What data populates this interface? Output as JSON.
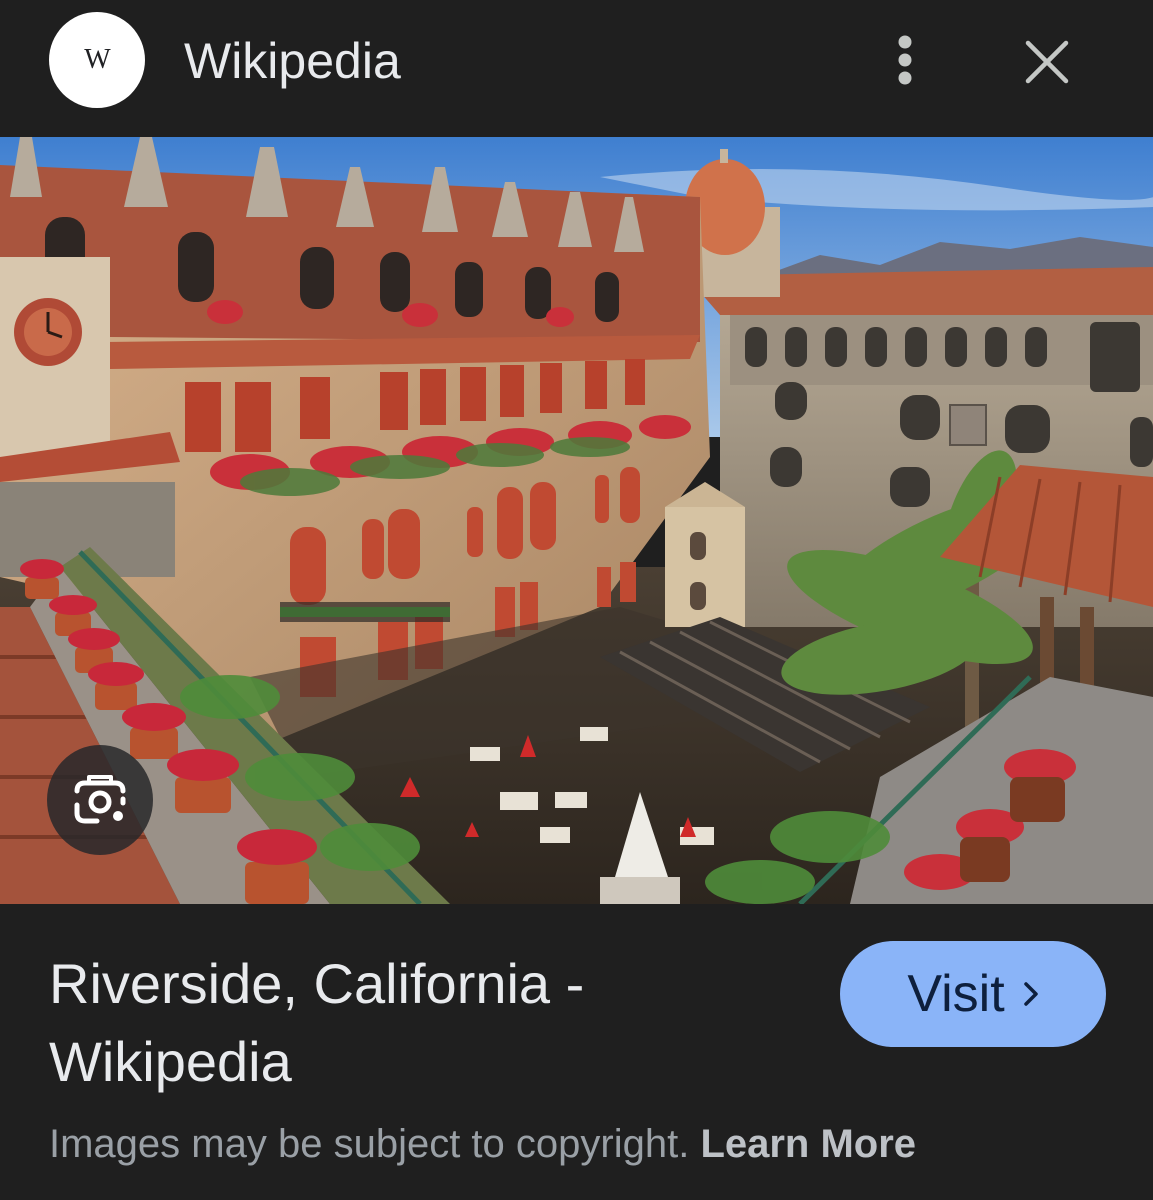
{
  "header": {
    "logo_letter": "W",
    "site_name": "Wikipedia"
  },
  "icons": {
    "logo": "wikipedia-logo",
    "more": "more-vert-icon",
    "close": "close-icon",
    "lens": "google-lens-icon",
    "chevron": "chevron-right-icon"
  },
  "image": {
    "subject": "Mission Inn courtyard, Riverside"
  },
  "result": {
    "title": "Riverside, California - Wikipedia",
    "visit_label": "Visit"
  },
  "footer": {
    "copyright_text": "Images may be subject to copyright.",
    "learn_more_label": "Learn More"
  },
  "colors": {
    "background": "#1f1f1f",
    "visit_button": "#8ab4f8",
    "text_primary": "#e8eaed",
    "text_secondary": "#9aa0a6"
  }
}
